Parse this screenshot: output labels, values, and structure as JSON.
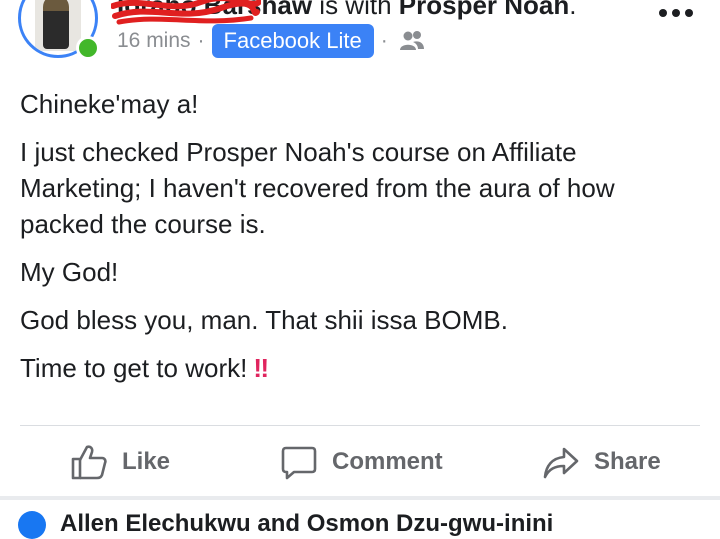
{
  "header": {
    "author_name": "Iorabo Barshaw",
    "with_text": "is with",
    "tagged_name": "Prosper Noah",
    "period": ".",
    "time_ago": "16 mins",
    "separator": "·",
    "app_badge": "Facebook Lite",
    "audience_icon": "friends-icon",
    "more_icon": "more-options-icon"
  },
  "post": {
    "paragraphs": [
      "Chineke'may a!",
      "I just checked Prosper Noah's course on Affiliate Marketing; I haven't recovered from the aura of how packed the course is.",
      "My God!",
      "God bless you, man. That shii issa BOMB.",
      "Time to get to work!"
    ],
    "emoji": "‼"
  },
  "actions": {
    "like": "Like",
    "comment": "Comment",
    "share": "Share"
  },
  "reactions": {
    "text": "Allen Elechukwu and Osmon Dzu-gwu-inini"
  },
  "colors": {
    "accent": "#3b82f6",
    "online": "#42b72a",
    "muted": "#65676b",
    "scribble": "#e02020"
  }
}
